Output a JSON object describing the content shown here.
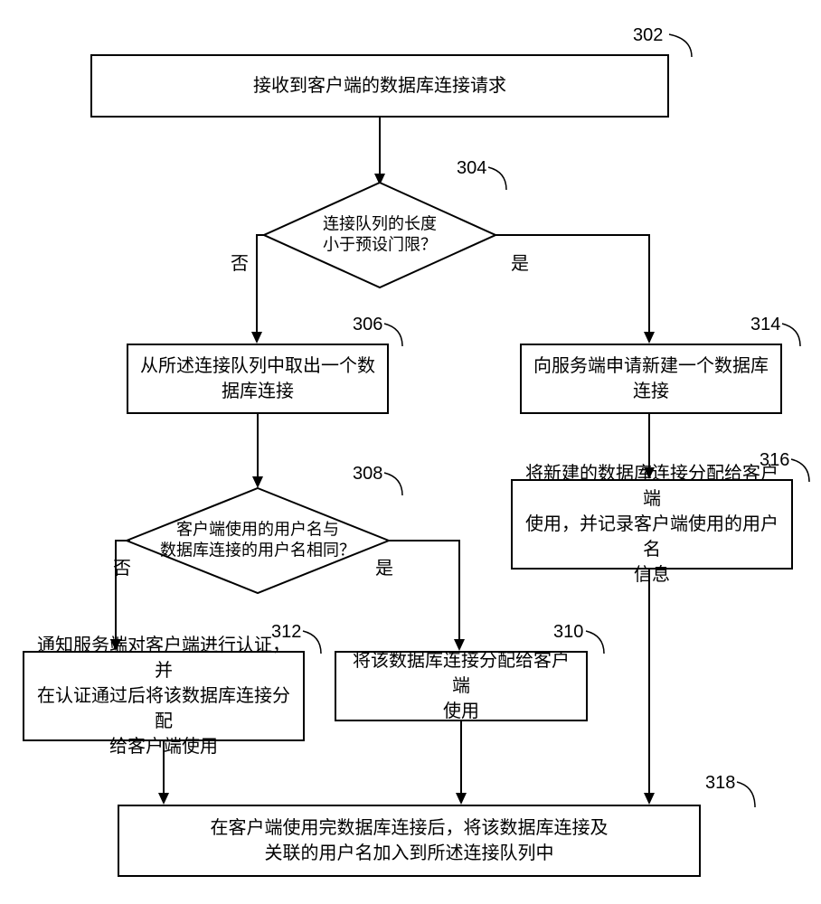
{
  "nodes": {
    "n302": {
      "num": "302",
      "text": "接收到客户端的数据库连接请求"
    },
    "n304": {
      "num": "304",
      "text": "连接队列的长度\n小于预设门限？",
      "no": "否",
      "yes": "是"
    },
    "n306": {
      "num": "306",
      "text": "从所述连接队列中取出一个数\n据库连接"
    },
    "n314": {
      "num": "314",
      "text": "向服务端申请新建一个数据库\n连接"
    },
    "n308": {
      "num": "308",
      "text": "客户端使用的用户名与\n数据库连接的用户名相同？",
      "no": "否",
      "yes": "是"
    },
    "n316": {
      "num": "316",
      "text": "将新建的数据库连接分配给客户端\n使用，并记录客户端使用的用户名\n信息"
    },
    "n312": {
      "num": "312",
      "text": "通知服务端对客户端进行认证，并\n在认证通过后将该数据库连接分配\n给客户端使用"
    },
    "n310": {
      "num": "310",
      "text": "将该数据库连接分配给客户端\n使用"
    },
    "n318": {
      "num": "318",
      "text": "在客户端使用完数据库连接后，将该数据库连接及\n关联的用户名加入到所述连接队列中"
    }
  }
}
